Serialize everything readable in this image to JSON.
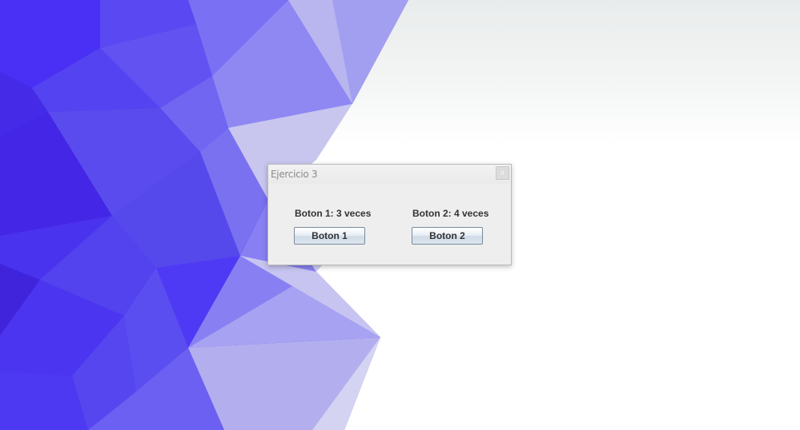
{
  "window": {
    "title": "Ejercicio 3",
    "close_symbol": "x",
    "close_icon": "close-icon"
  },
  "panel": {
    "label1": "Boton 1: 3 veces",
    "label2": "Boton 2: 4 veces",
    "button1": "Boton 1",
    "button2": "Boton 2"
  },
  "colors": {
    "wallpaper_primary": "#4a2ff5",
    "wallpaper_light": "#b7b5ee",
    "window_bg": "#eeeeee"
  }
}
